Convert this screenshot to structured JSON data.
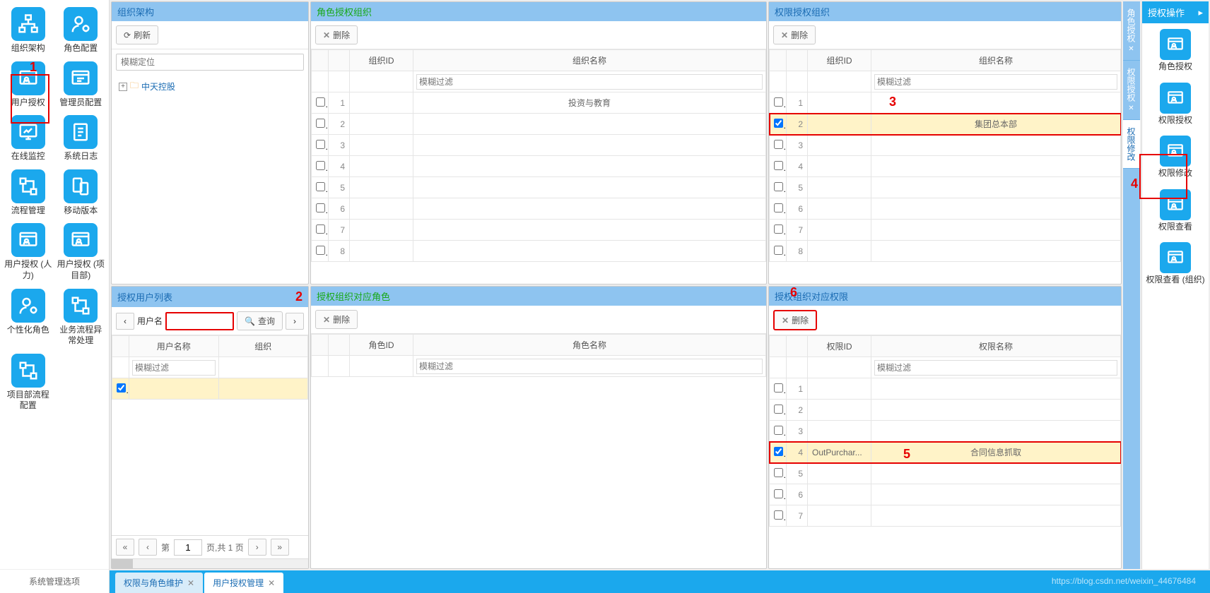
{
  "leftNav": [
    {
      "label": "组织架构",
      "icon": "org"
    },
    {
      "label": "角色配置",
      "icon": "rolecfg"
    },
    {
      "label": "用户授权",
      "icon": "userauth",
      "active": true
    },
    {
      "label": "管理员配置",
      "icon": "admin"
    },
    {
      "label": "在线监控",
      "icon": "monitor"
    },
    {
      "label": "系统日志",
      "icon": "log"
    },
    {
      "label": "流程管理",
      "icon": "flow"
    },
    {
      "label": "移动版本",
      "icon": "mobile"
    },
    {
      "label": "用户授权 (人力)",
      "icon": "userauth"
    },
    {
      "label": "用户授权 (项目部)",
      "icon": "userauth"
    },
    {
      "label": "个性化角色",
      "icon": "rolecfg"
    },
    {
      "label": "业务流程异常处理",
      "icon": "flow"
    },
    {
      "label": "项目部流程配置",
      "icon": "flow"
    }
  ],
  "leftNavFooter": "系统管理选项",
  "orgPanel": {
    "title": "组织架构",
    "refresh": "刷新",
    "searchPlaceholder": "模糊定位",
    "treeRoot": "中天控股"
  },
  "userListPanel": {
    "title": "授权用户列表",
    "userFieldLabel": "用户名",
    "queryBtn": "查询",
    "colUserName": "用户名称",
    "colOrg": "组织",
    "filterPlaceholder": "模糊过滤",
    "pagerPrefix": "第",
    "pagerSuffix": "页,共 1 页",
    "pagerPage": "1"
  },
  "roleAuthOrgPanel": {
    "title": "角色授权组织",
    "deleteBtn": "删除",
    "colOrgId": "组织ID",
    "colOrgName": "组织名称",
    "filterPlaceholder": "模糊过滤",
    "rows": [
      {
        "n": "1",
        "name": "投资与教育"
      },
      {
        "n": "2",
        "name": ""
      },
      {
        "n": "3",
        "name": ""
      },
      {
        "n": "4",
        "name": ""
      },
      {
        "n": "5",
        "name": ""
      },
      {
        "n": "6",
        "name": ""
      },
      {
        "n": "7",
        "name": ""
      },
      {
        "n": "8",
        "name": ""
      }
    ]
  },
  "permAuthOrgPanel": {
    "title": "权限授权组织",
    "deleteBtn": "删除",
    "colOrgId": "组织ID",
    "colOrgName": "组织名称",
    "filterPlaceholder": "模糊过滤",
    "rows": [
      {
        "n": "1",
        "name": ""
      },
      {
        "n": "2",
        "name": "集团总本部",
        "checked": true
      },
      {
        "n": "3",
        "name": ""
      },
      {
        "n": "4",
        "name": ""
      },
      {
        "n": "5",
        "name": ""
      },
      {
        "n": "6",
        "name": ""
      },
      {
        "n": "7",
        "name": ""
      },
      {
        "n": "8",
        "name": ""
      }
    ]
  },
  "orgRolesPanel": {
    "title": "授权组织对应角色",
    "deleteBtn": "删除",
    "colRoleId": "角色ID",
    "colRoleName": "角色名称",
    "filterPlaceholder": "模糊过滤"
  },
  "orgPermPanel": {
    "title": "授权组织对应权限",
    "deleteBtn": "删除",
    "colPermId": "权限ID",
    "colPermName": "权限名称",
    "filterPlaceholder": "模糊过滤",
    "rows": [
      {
        "n": "1",
        "id": "",
        "name": ""
      },
      {
        "n": "2",
        "id": "",
        "name": ""
      },
      {
        "n": "3",
        "id": "",
        "name": ""
      },
      {
        "n": "4",
        "id": "OutPurchar...",
        "name": "合同信息抓取",
        "checked": true
      },
      {
        "n": "5",
        "id": "",
        "name": ""
      },
      {
        "n": "6",
        "id": "",
        "name": ""
      },
      {
        "n": "7",
        "id": "",
        "name": ""
      }
    ]
  },
  "vtabs": [
    {
      "label": "角色授权"
    },
    {
      "label": "权限授权"
    },
    {
      "label": "权限修改",
      "active": true
    }
  ],
  "rightNav": {
    "title": "授权操作",
    "items": [
      {
        "label": "角色授权"
      },
      {
        "label": "权限授权"
      },
      {
        "label": "权限修改",
        "active": true
      },
      {
        "label": "权限查看"
      },
      {
        "label": "权限查看 (组织)"
      }
    ]
  },
  "bottomTabs": [
    {
      "label": "权限与角色维护"
    },
    {
      "label": "用户授权管理",
      "active": true
    }
  ],
  "watermark": "https://blog.csdn.net/weixin_44676484",
  "annotations": {
    "n1": "1",
    "n2": "2",
    "n3": "3",
    "n4": "4",
    "n5": "5",
    "n6": "6"
  }
}
